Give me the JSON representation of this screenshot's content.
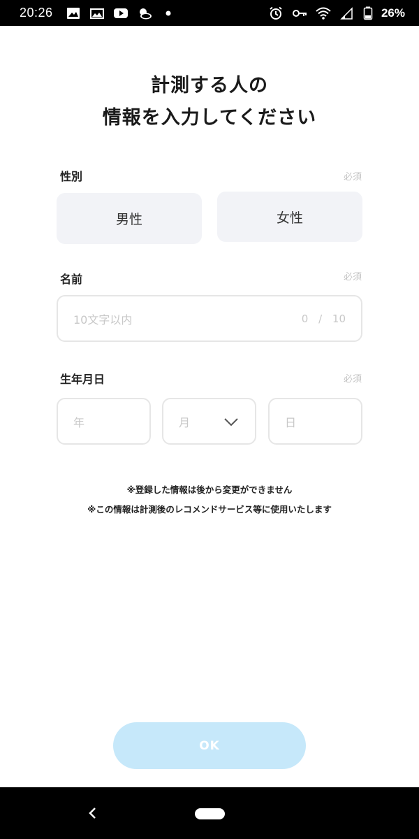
{
  "status_bar": {
    "time": "20:26",
    "battery": "26%",
    "left_icons": [
      "image-icon",
      "photo-gallery-icon",
      "youtube-icon",
      "weather-icon",
      "dot-icon"
    ],
    "right_icons": [
      "alarm-icon",
      "key-icon",
      "wifi-icon",
      "signal-icon",
      "battery-icon"
    ]
  },
  "header": {
    "title_line1": "計測する人の",
    "title_line2": "情報を入力してください"
  },
  "gender": {
    "label": "性別",
    "required": "必須",
    "male": "男性",
    "female": "女性"
  },
  "name": {
    "label": "名前",
    "required": "必須",
    "placeholder": "10文字以内",
    "counter": "0 / 10"
  },
  "birthday": {
    "label": "生年月日",
    "required": "必須",
    "year_placeholder": "年",
    "month_placeholder": "月",
    "day_placeholder": "日"
  },
  "notices": {
    "line1": "※登録した情報は後から変更ができません",
    "line2": "※この情報は計測後のレコメンドサービス等に使用いたします"
  },
  "ok_button": {
    "label": "OK",
    "color": "#c6e8fa"
  }
}
